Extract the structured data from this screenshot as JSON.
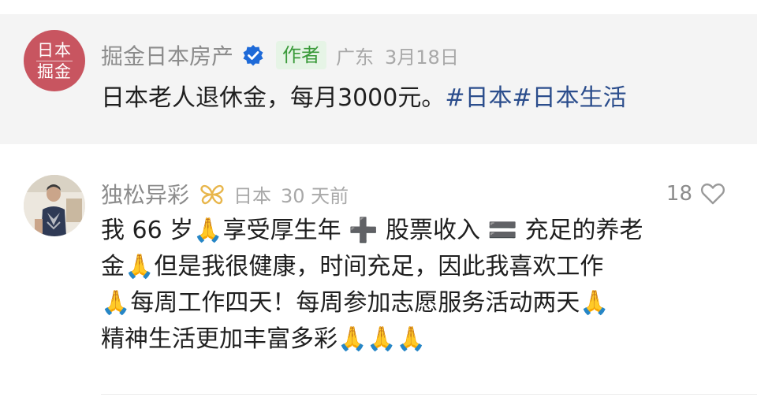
{
  "post": {
    "author": {
      "avatar_text_top": "日本",
      "avatar_text_bottom": "掘金",
      "name": "掘金日本房产",
      "tag": "作者",
      "location": "广东",
      "date": "3月18日"
    },
    "text": "日本老人退休金，每月3000元。",
    "hashtags": [
      "#日本",
      "#日本生活"
    ]
  },
  "comment": {
    "author": "独松异彩",
    "location": "日本",
    "date": "30 天前",
    "likes": "18",
    "lines": [
      "我 66 岁🙏享受厚生年 ➕ 股票收入 🟰 充足的养老",
      "金🙏但是我很健康，时间充足，因此我喜欢工作",
      "🙏每周工作四天！每周参加志愿服务活动两天🙏",
      "精神生活更加丰富多彩🙏🙏🙏"
    ]
  },
  "colors": {
    "avatar_brand": "#c85560",
    "verified_blue": "#1e6ad8",
    "author_tag_green": "#3a9a3a",
    "hashtag_blue": "#2b4d8c",
    "butterfly_gold": "#e8b64c"
  },
  "icons": {
    "verified": "verified-badge-icon",
    "commenter_badge": "butterfly-icon",
    "like": "heart-icon"
  }
}
